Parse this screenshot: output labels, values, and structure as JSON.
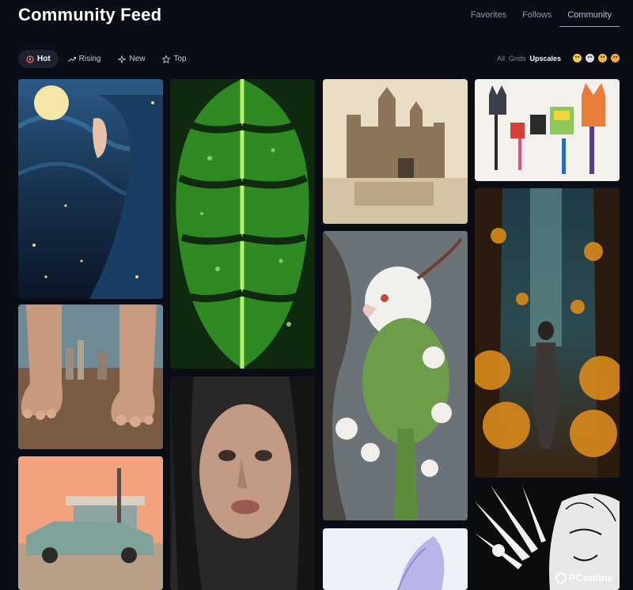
{
  "header": {
    "title": "Community Feed",
    "tabs": [
      {
        "label": "Favorites",
        "active": false
      },
      {
        "label": "Follows",
        "active": false
      },
      {
        "label": "Community",
        "active": true
      }
    ]
  },
  "filters": [
    {
      "label": "Hot",
      "icon": "flame-icon",
      "active": true
    },
    {
      "label": "Rising",
      "icon": "trending-up-icon",
      "active": false
    },
    {
      "label": "New",
      "icon": "sparkle-icon",
      "active": false
    },
    {
      "label": "Top",
      "icon": "star-icon",
      "active": false
    }
  ],
  "view_options": {
    "all": "All",
    "grids": "Grids",
    "upscales": "Upscales",
    "active": "Upscales",
    "reactions": [
      "neutral-face-icon",
      "sad-face-icon",
      "heart-eyes-icon",
      "star-struck-icon"
    ]
  },
  "gallery": [
    {
      "name": "gallery-image-starry-night-woman",
      "subject": "woman with flowing blue hair under starry night and crescent moon"
    },
    {
      "name": "gallery-image-giant-feet-city",
      "subject": "giant bare feet standing over a city"
    },
    {
      "name": "gallery-image-retro-gas-station",
      "subject": "old car parked at retro gas station at sunset"
    },
    {
      "name": "gallery-image-monstera-leaf",
      "subject": "green monstera leaf with water drops"
    },
    {
      "name": "gallery-image-wet-woman-portrait",
      "subject": "portrait of a woman with wet hair"
    },
    {
      "name": "gallery-image-castle-sketch",
      "subject": "sepia sketch of a castle reflected in water"
    },
    {
      "name": "gallery-image-white-parrot",
      "subject": "white and green parrot among white flowers"
    },
    {
      "name": "gallery-image-lavender-flower",
      "subject": "pale lavender flower"
    },
    {
      "name": "gallery-image-doodle-cats",
      "subject": "colorful doodle drawing of cats"
    },
    {
      "name": "gallery-image-forest-explorer",
      "subject": "explorer walking in an autumn forest"
    },
    {
      "name": "gallery-image-comic-woman",
      "subject": "black and white comic art of a woman"
    }
  ],
  "colors": {
    "background": "#0b0d16",
    "active_pill": "#1c2230",
    "active_tab_underline": "#9aa3b8"
  },
  "watermark": "PConline"
}
